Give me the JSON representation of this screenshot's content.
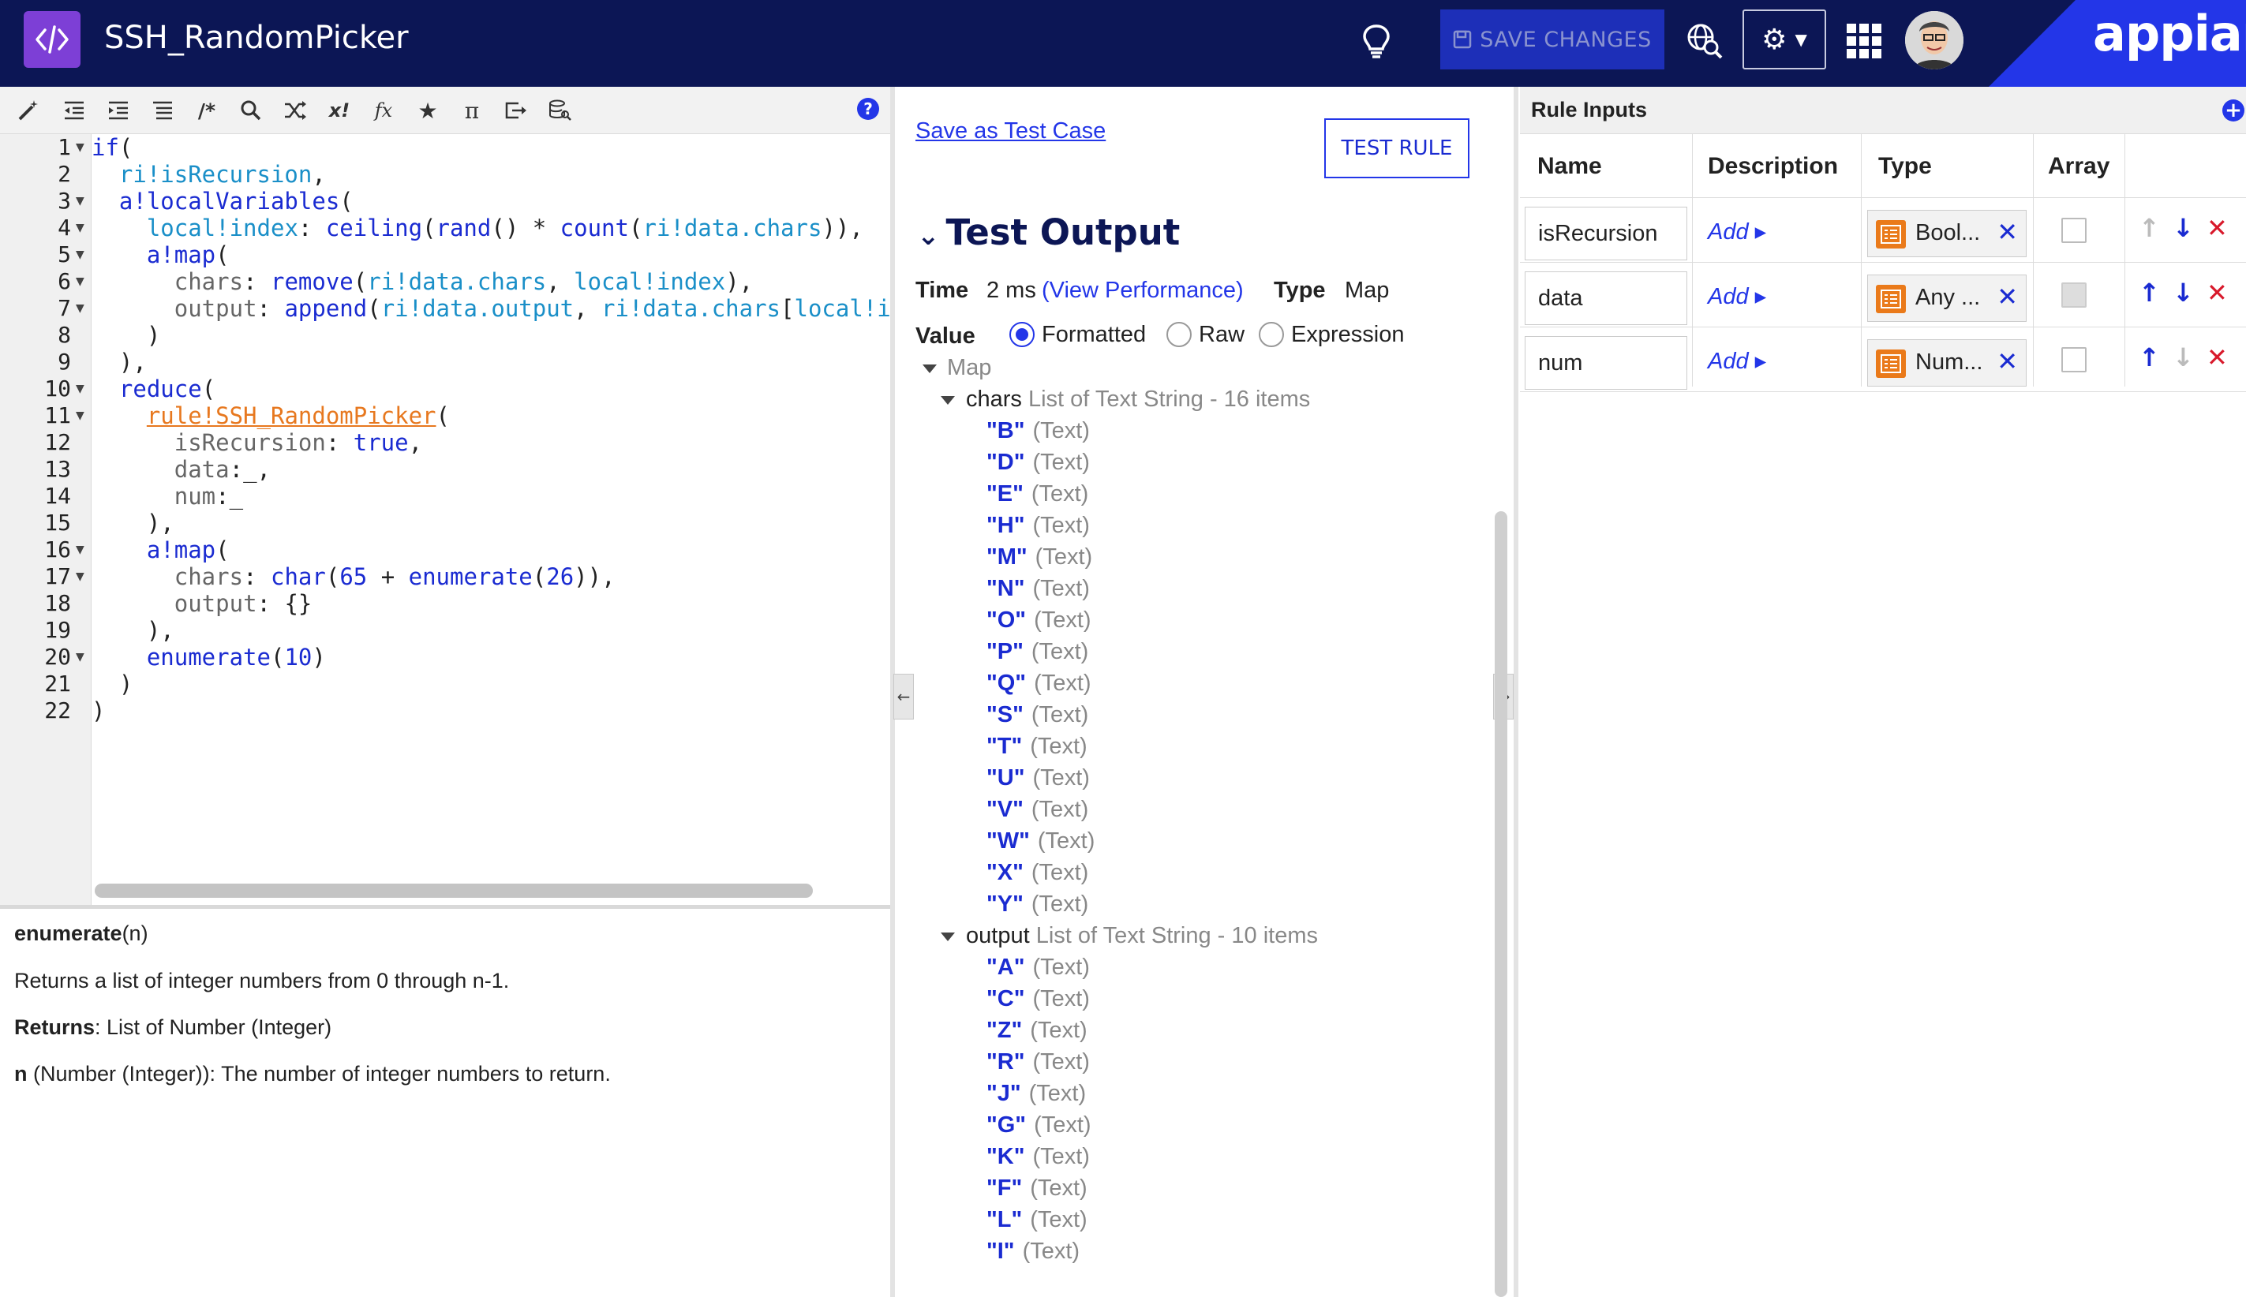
{
  "header": {
    "app_title": "SSH_RandomPicker",
    "save_label": "SAVE CHANGES",
    "brand": "appian"
  },
  "editor": {
    "toolbar_icons": [
      "wand-icon",
      "outdent-icon",
      "indent-icon",
      "list-icon",
      "comment-icon",
      "search-icon",
      "shuffle-icon",
      "variable-icon",
      "function-icon",
      "star-icon",
      "pi-icon",
      "export-icon",
      "query-icon"
    ],
    "line_numbers": [
      "1",
      "2",
      "3",
      "4",
      "5",
      "6",
      "7",
      "8",
      "9",
      "10",
      "11",
      "12",
      "13",
      "14",
      "15",
      "16",
      "17",
      "18",
      "19",
      "20",
      "21",
      "22"
    ],
    "folded_lines": [
      1,
      3,
      4,
      5,
      6,
      7,
      10,
      11,
      16,
      17,
      20
    ],
    "code_lines": [
      "if(",
      "  ri!isRecursion,",
      "  a!localVariables(",
      "    local!index: ceiling(rand() * count(ri!data.chars)),",
      "    a!map(",
      "      chars: remove(ri!data.chars, local!index),",
      "      output: append(ri!data.output, ri!data.chars[local!index])",
      "    )",
      "  ),",
      "  reduce(",
      "    rule!SSH_RandomPicker(",
      "      isRecursion: true,",
      "      data:_,",
      "      num:_",
      "    ),",
      "    a!map(",
      "      chars: char(65 + enumerate(26)),",
      "      output: {}",
      "    ),",
      "    enumerate(10)",
      "  )",
      ")"
    ],
    "doc": {
      "signature_name": "enumerate",
      "signature_args": "(n)",
      "description": "Returns a list of integer numbers from 0 through n-1.",
      "returns_label": "Returns",
      "returns_value": ": List of Number (Integer)",
      "param_name": "n",
      "param_desc": " (Number (Integer)): The number of integer numbers to return."
    }
  },
  "test": {
    "save_test_case": "Save as Test Case",
    "test_rule": "TEST RULE",
    "output_title": "Test Output",
    "time_label": "Time",
    "time_value": "2 ms",
    "view_performance": "(View Performance)",
    "type_label": "Type",
    "type_value": "Map",
    "value_label": "Value",
    "radio_options": [
      "Formatted",
      "Raw",
      "Expression"
    ],
    "selected_radio": "Formatted",
    "root": "Map",
    "chars": {
      "name": "chars",
      "desc": "List of Text String - 16 items",
      "items": [
        "\"B\"",
        "\"D\"",
        "\"E\"",
        "\"H\"",
        "\"M\"",
        "\"N\"",
        "\"O\"",
        "\"P\"",
        "\"Q\"",
        "\"S\"",
        "\"T\"",
        "\"U\"",
        "\"V\"",
        "\"W\"",
        "\"X\"",
        "\"Y\""
      ]
    },
    "output": {
      "name": "output",
      "desc": "List of Text String - 10 items",
      "items": [
        "\"A\"",
        "\"C\"",
        "\"Z\"",
        "\"R\"",
        "\"J\"",
        "\"G\"",
        "\"K\"",
        "\"F\"",
        "\"L\"",
        "\"I\""
      ]
    },
    "item_type": "(Text)"
  },
  "rule_inputs": {
    "title": "Rule Inputs",
    "columns": [
      "Name",
      "Description",
      "Type",
      "Array"
    ],
    "add_label": "Add",
    "rows": [
      {
        "name": "isRecursion",
        "type": "Bool...",
        "array": false,
        "array_disabled": false,
        "up_enabled": false,
        "down_enabled": true
      },
      {
        "name": "data",
        "type": "Any ...",
        "array": false,
        "array_disabled": true,
        "up_enabled": true,
        "down_enabled": true
      },
      {
        "name": "num",
        "type": "Num...",
        "array": false,
        "array_disabled": false,
        "up_enabled": true,
        "down_enabled": false
      }
    ]
  },
  "colors": {
    "header_bg": "#0c1655",
    "accent": "#2336e8",
    "app_icon": "#7d3fd6",
    "rule_ref": "#e7781f",
    "delete": "#d8192b"
  }
}
